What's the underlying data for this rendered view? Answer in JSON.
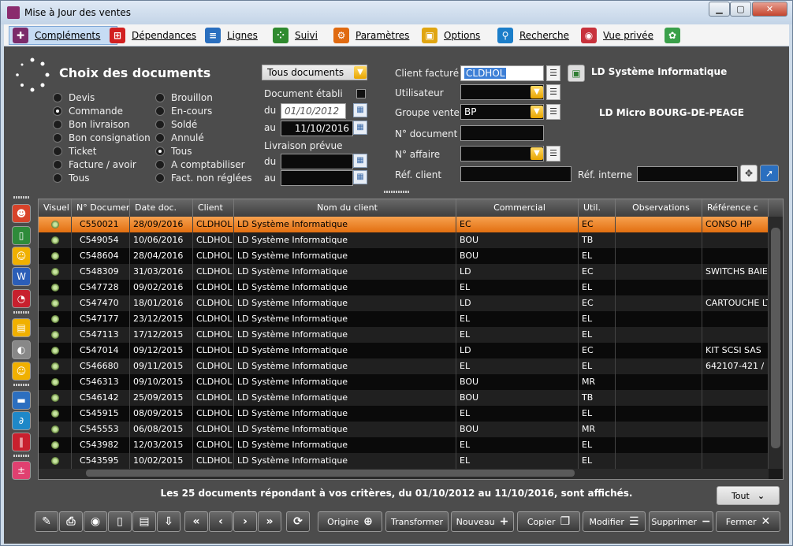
{
  "window": {
    "title": "Mise à Jour des ventes",
    "close_glyph": "✕",
    "min_glyph": "▁",
    "max_glyph": "▢"
  },
  "menu": [
    {
      "label": "Compléments",
      "icon": "complements-icon",
      "color": "#7b2b6a",
      "glyph": "✚"
    },
    {
      "label": "Dépendances",
      "icon": "dependencies-icon",
      "color": "#d22020",
      "glyph": "⊞"
    },
    {
      "label": "Lignes",
      "icon": "lines-icon",
      "color": "#2a6fbf",
      "glyph": "≡"
    },
    {
      "label": "Suivi",
      "icon": "footsteps-icon",
      "color": "#2f8a2f",
      "glyph": "⁘"
    },
    {
      "label": "Paramètres",
      "icon": "gear-icon",
      "color": "#e06a10",
      "glyph": "⚙"
    },
    {
      "label": "Options",
      "icon": "options-icon",
      "color": "#e0a510",
      "glyph": "▣"
    },
    {
      "label": "Recherche",
      "icon": "search-icon",
      "color": "#1c7ec9",
      "glyph": "⚲"
    },
    {
      "label": "Vue privée",
      "icon": "private-view-icon",
      "color": "#c8323c",
      "glyph": "◉"
    },
    {
      "label": "",
      "icon": "palette-icon",
      "color": "#3aa04a",
      "glyph": "✿"
    }
  ],
  "filters": {
    "section_title": "Choix des documents",
    "doc_types_left": [
      "Devis",
      "Commande",
      "Bon livraison",
      "Bon consignation",
      "Ticket",
      "Facture / avoir",
      "Tous"
    ],
    "doc_types_right": [
      "Brouillon",
      "En-cours",
      "Soldé",
      "Annulé",
      "Tous",
      "A comptabiliser",
      "Fact. non réglées"
    ],
    "doc_type_selected": "Commande",
    "status_selected": "Tous",
    "doc_select": "Tous documents",
    "doc_etabli_label": "Document établi",
    "du_label": "du",
    "au_label": "au",
    "etabli_du": "01/10/2012",
    "etabli_au": "11/10/2016",
    "livraison_label": "Livraison prévue",
    "livraison_du": "",
    "livraison_au": "",
    "client_label": "Client facturé",
    "client_value": "CLDHOL",
    "client_name": "LD Système Informatique",
    "utilisateur_label": "Utilisateur",
    "utilisateur_value": "",
    "groupe_label": "Groupe vente",
    "groupe_value": "BP",
    "groupe_name": "LD Micro BOURG-DE-PEAGE",
    "ndoc_label": "N° document",
    "ndoc_value": "",
    "naffaire_label": "N° affaire",
    "naffaire_value": "",
    "refclient_label": "Réf. client",
    "refclient_value": "",
    "refinterne_label": "Réf. interne",
    "refinterne_value": ""
  },
  "sidebar": [
    {
      "icon": "user-icon",
      "color": "#d8432a",
      "glyph": "☻"
    },
    {
      "icon": "phone-icon",
      "color": "#2e8b3a",
      "glyph": "▯"
    },
    {
      "icon": "contacts-icon",
      "color": "#f0b000",
      "glyph": "☺"
    },
    {
      "icon": "word-icon",
      "color": "#2b5eb8",
      "glyph": "W"
    },
    {
      "icon": "alarm-clock-icon",
      "color": "#c8202e",
      "glyph": "◔"
    },
    {
      "icon": "lock-icon",
      "color": "#f0b000",
      "glyph": "▤"
    },
    {
      "icon": "moon-icon",
      "color": "#888888",
      "glyph": "◐"
    },
    {
      "icon": "group-icon",
      "color": "#f0b000",
      "glyph": "☺"
    },
    {
      "icon": "folder-icon",
      "color": "#2c6fc0",
      "glyph": "▬"
    },
    {
      "icon": "paperclip-icon",
      "color": "#1e88c8",
      "glyph": "∂"
    },
    {
      "icon": "barcode-icon",
      "color": "#c8202e",
      "glyph": "‖"
    },
    {
      "icon": "calculator-icon",
      "color": "#e04070",
      "glyph": "±"
    }
  ],
  "grid": {
    "headers": [
      "Visuel",
      "N° Document",
      "Date doc.",
      "Client",
      "Nom du client",
      "Commercial",
      "Util.",
      "Observations",
      "Référence c"
    ],
    "rows": [
      [
        "C550021",
        "28/09/2016",
        "CLDHOL",
        "LD Système Informatique",
        "EC",
        "EC",
        "",
        "CONSO HP"
      ],
      [
        "C549054",
        "10/06/2016",
        "CLDHOL",
        "LD Système Informatique",
        "BOU",
        "TB",
        "",
        ""
      ],
      [
        "C548604",
        "28/04/2016",
        "CLDHOL",
        "LD Système Informatique",
        "BOU",
        "EL",
        "",
        ""
      ],
      [
        "C548309",
        "31/03/2016",
        "CLDHOL",
        "LD Système Informatique",
        "LD",
        "EC",
        "",
        "SWITCHS BAIE"
      ],
      [
        "C547728",
        "09/02/2016",
        "CLDHOL",
        "LD Système Informatique",
        "EL",
        "EL",
        "",
        ""
      ],
      [
        "C547470",
        "18/01/2016",
        "CLDHOL",
        "LD Système Informatique",
        "LD",
        "EC",
        "",
        "CARTOUCHE LT"
      ],
      [
        "C547177",
        "23/12/2015",
        "CLDHOL",
        "LD Système Informatique",
        "EL",
        "EL",
        "",
        ""
      ],
      [
        "C547113",
        "17/12/2015",
        "CLDHOL",
        "LD Système Informatique",
        "EL",
        "EL",
        "",
        ""
      ],
      [
        "C547014",
        "09/12/2015",
        "CLDHOL",
        "LD Système Informatique",
        "LD",
        "EC",
        "",
        "KIT SCSI SAS"
      ],
      [
        "C546680",
        "09/11/2015",
        "CLDHOL",
        "LD Système Informatique",
        "EL",
        "EL",
        "",
        "642107-421 /"
      ],
      [
        "C546313",
        "09/10/2015",
        "CLDHOL",
        "LD Système Informatique",
        "BOU",
        "MR",
        "",
        ""
      ],
      [
        "C546142",
        "25/09/2015",
        "CLDHOL",
        "LD Système Informatique",
        "BOU",
        "TB",
        "",
        ""
      ],
      [
        "C545915",
        "08/09/2015",
        "CLDHOL",
        "LD Système Informatique",
        "EL",
        "EL",
        "",
        ""
      ],
      [
        "C545553",
        "06/08/2015",
        "CLDHOL",
        "LD Système Informatique",
        "BOU",
        "MR",
        "",
        ""
      ],
      [
        "C543982",
        "12/03/2015",
        "CLDHOL",
        "LD Système Informatique",
        "EL",
        "EL",
        "",
        ""
      ],
      [
        "C543595",
        "10/02/2015",
        "CLDHOL",
        "LD Système Informatique",
        "EL",
        "EL",
        "",
        ""
      ]
    ],
    "selected_row": 0
  },
  "status_text": "Les 25 documents répondant à vos critères, du 01/10/2012 au 11/10/2016, sont affichés.",
  "tout_label": "Tout",
  "toolbar": [
    {
      "name": "edit-button",
      "label": "",
      "glyph": "✎"
    },
    {
      "name": "print-button",
      "label": "",
      "glyph": "⎙"
    },
    {
      "name": "view-button",
      "label": "",
      "glyph": "◉"
    },
    {
      "name": "mobile-button",
      "label": "",
      "glyph": "▯"
    },
    {
      "name": "card-button",
      "label": "",
      "glyph": "▤"
    },
    {
      "name": "export-button",
      "label": "",
      "glyph": "⇩"
    },
    {
      "name": "first-button",
      "label": "",
      "glyph": "«"
    },
    {
      "name": "prev-button",
      "label": "",
      "glyph": "‹"
    },
    {
      "name": "next-button",
      "label": "",
      "glyph": "›"
    },
    {
      "name": "last-button",
      "label": "",
      "glyph": "»"
    },
    {
      "name": "refresh-button",
      "label": "",
      "glyph": "⟳"
    },
    {
      "name": "origine-button",
      "label": "Origine",
      "glyph": "⊕"
    },
    {
      "name": "transformer-button",
      "label": "Transformer",
      "glyph": ""
    },
    {
      "name": "nouveau-button",
      "label": "Nouveau",
      "glyph": "+"
    },
    {
      "name": "copier-button",
      "label": "Copier",
      "glyph": "❐"
    },
    {
      "name": "modifier-button",
      "label": "Modifier",
      "glyph": "☰"
    },
    {
      "name": "supprimer-button",
      "label": "Supprimer",
      "glyph": "−"
    },
    {
      "name": "fermer-button",
      "label": "Fermer",
      "glyph": "✕"
    }
  ]
}
